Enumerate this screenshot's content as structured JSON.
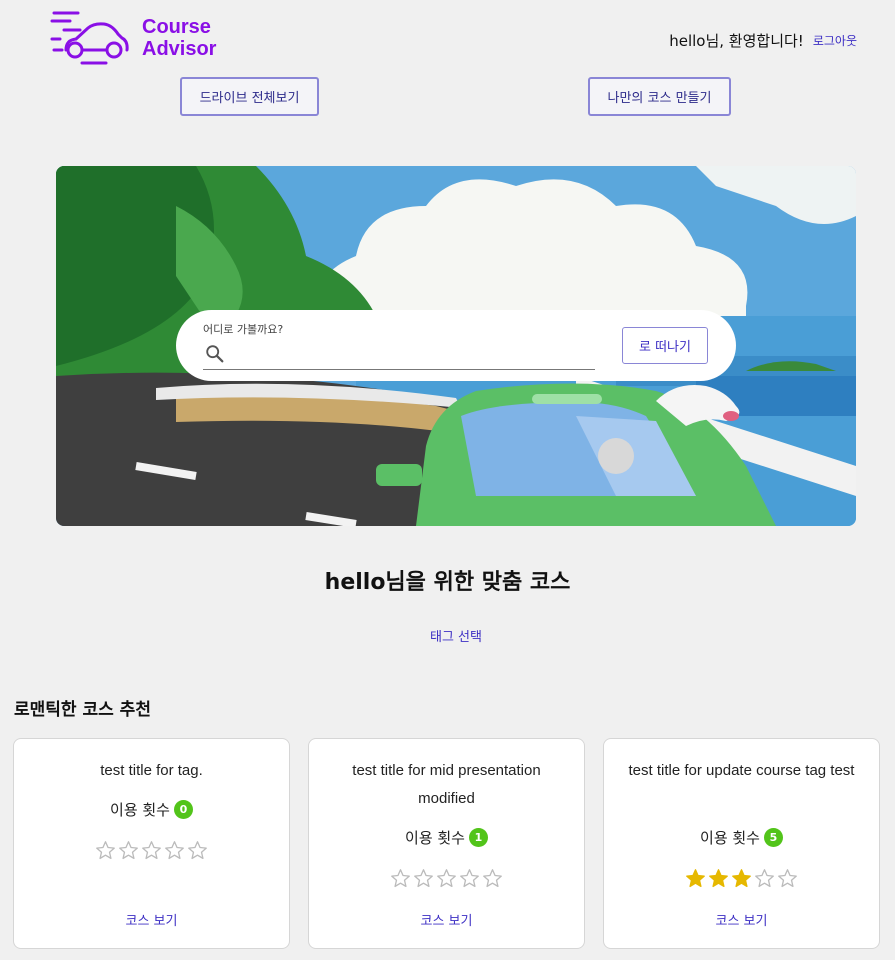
{
  "header": {
    "logo_line1": "Course",
    "logo_line2": "Advisor",
    "greeting": "hello님, 환영합니다!",
    "logout": "로그아웃",
    "brand_color": "#8a0fe6"
  },
  "nav": {
    "drive_all": "드라이브 전체보기",
    "make_course": "나만의 코스 만들기"
  },
  "search": {
    "label": "어디로 가볼까요?",
    "value": "",
    "go_button": "로 떠나기"
  },
  "recommend": {
    "title": "hello님을 위한 맞춤 코스",
    "tag_select": "태그 선택"
  },
  "category": {
    "title": "로맨틱한 코스 추천",
    "cards": [
      {
        "title": "test title for tag.",
        "usage_label": "이용 횟수",
        "usage_count": "0",
        "rating": 0,
        "view": "코스 보기"
      },
      {
        "title": "test title for mid presentation modified",
        "usage_label": "이용 횟수",
        "usage_count": "1",
        "rating": 0,
        "view": "코스 보기"
      },
      {
        "title": "test title for update course tag test",
        "usage_label": "이용 횟수",
        "usage_count": "5",
        "rating": 3,
        "view": "코스 보기"
      }
    ]
  },
  "colors": {
    "accent": "#3d2fc4",
    "badge": "#52c41a",
    "star": "#e6b800"
  }
}
